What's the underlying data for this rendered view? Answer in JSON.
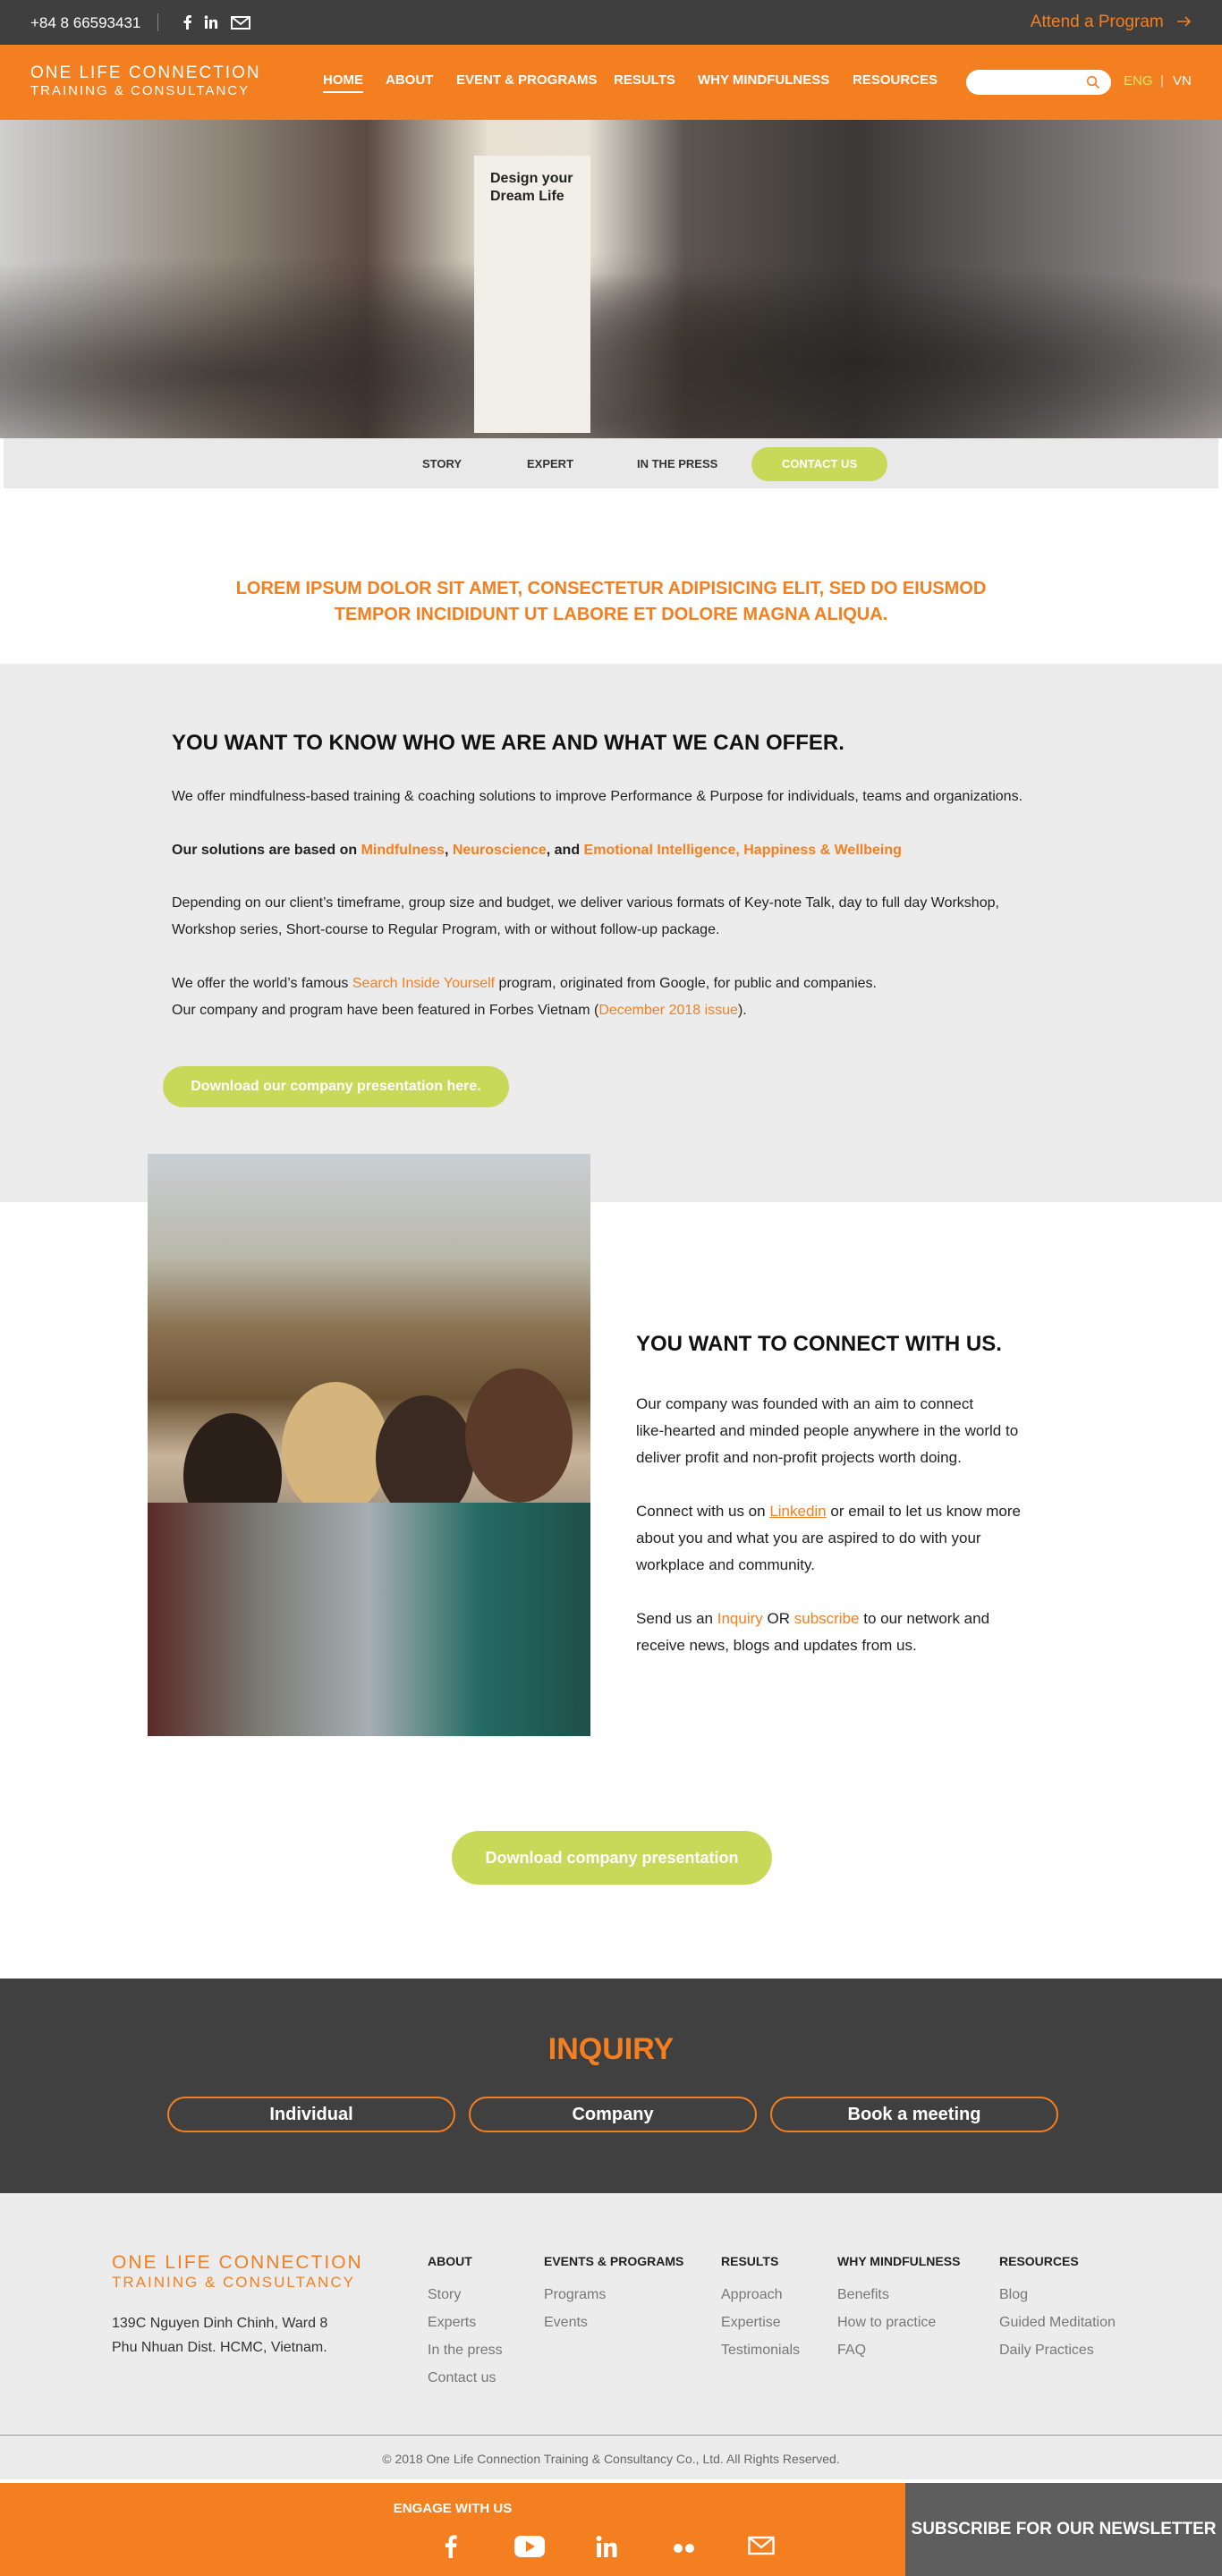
{
  "topbar": {
    "phone": "+84 8 66593431",
    "social_icons": [
      "facebook-icon",
      "linkedin-icon",
      "mail-icon"
    ],
    "attend": "Attend a Program"
  },
  "nav": {
    "logo_line1": "ONE LIFE CONNECTION",
    "logo_line2": "TRAINING & CONSULTANCY",
    "items": [
      "HOME",
      "ABOUT",
      "EVENT & PROGRAMS",
      "RESULTS",
      "WHY MINDFULNESS",
      "RESOURCES"
    ],
    "active": "HOME",
    "search_placeholder": "",
    "lang_en": "ENG",
    "lang_sep": "|",
    "lang_vn": "VN"
  },
  "hero": {
    "banner_text": "Design your Dream Life"
  },
  "subnav": {
    "items": [
      "STORY",
      "EXPERT",
      "IN THE PRESS",
      "CONTACT US"
    ]
  },
  "intro": {
    "line1": "LOREM IPSUM DOLOR SIT AMET, CONSECTETUR ADIPISICING ELIT, SED DO EIUSMOD",
    "line2": "TEMPOR INCIDIDUNT UT LABORE ET DOLORE MAGNA ALIQUA."
  },
  "section1": {
    "heading": "YOU WANT TO KNOW WHO WE ARE AND WHAT WE CAN OFFER.",
    "p1": "We offer mindfulness-based training & coaching solutions to improve Performance & Purpose for individuals, teams and organizations.",
    "p2_prefix": "Our solutions are based on ",
    "p2_a": "Mindfulness",
    "p2_sep1": ", ",
    "p2_b": "Neuroscience",
    "p2_sep2": ", and ",
    "p2_c": "Emotional Intelligence, Happiness & Wellbeing",
    "p3_line1": "Depending on our client’s timeframe, group size and budget, we deliver various formats of Key-note Talk, day to full day Workshop,",
    "p3_line2": "Workshop series, Short-course to Regular Program, with or without follow-up package.",
    "p4_prefix": "We offer the world’s famous ",
    "p4_link": "Search Inside Yourself",
    "p4_suffix": " program, originated from Google, for public and companies.",
    "p5_prefix": "Our company and program have been featured in Forbes Vietnam (",
    "p5_link": "December 2018 issue",
    "p5_suffix": ").",
    "button": "Download our company presentation here."
  },
  "section2": {
    "heading": "YOU WANT TO CONNECT WITH US.",
    "p1_l1": "Our company was founded with an aim to connect",
    "p1_l2": "like-hearted and minded people anywhere in the world to",
    "p1_l3": "deliver profit and non-profit projects worth doing.",
    "p2_prefix": "Connect with us on ",
    "p2_link": "Linkedin",
    "p2_suffix": " or email to let us know more",
    "p2_l2": "about you and what you are aspired to do with your",
    "p2_l3": "workplace and community.",
    "p3_prefix": "Send us an ",
    "p3_link1": "Inquiry",
    "p3_mid": " OR ",
    "p3_link2": "subscribe",
    "p3_suffix": " to our network and",
    "p3_l2": "receive news, blogs and updates from us.",
    "button": "Download company presentation"
  },
  "inquiry": {
    "title": "INQUIRY",
    "buttons": [
      "Individual",
      "Company",
      "Book a meeting"
    ]
  },
  "footer": {
    "logo_line1": "ONE LIFE CONNECTION",
    "logo_line2": "TRAINING & CONSULTANCY",
    "address_l1": "139C Nguyen Dinh Chinh, Ward 8",
    "address_l2": "Phu Nhuan Dist. HCMC, Vietnam.",
    "columns": [
      {
        "head": "ABOUT",
        "links": [
          "Story",
          "Experts",
          "In the press",
          "Contact us"
        ]
      },
      {
        "head": "EVENTS & PROGRAMS",
        "links": [
          "Programs",
          "Events"
        ]
      },
      {
        "head": "RESULTS",
        "links": [
          "Approach",
          "Expertise",
          "Testimonials"
        ]
      },
      {
        "head": "WHY MINDFULNESS",
        "links": [
          "Benefits",
          "How to practice",
          "FAQ"
        ]
      },
      {
        "head": "RESOURCES",
        "links": [
          "Blog",
          "Guided Meditation",
          "Daily Practices"
        ]
      }
    ],
    "copyright": "© 2018 One Life Connection Training & Consultancy Co., Ltd. All Rights Reserved."
  },
  "engage": {
    "title": "ENGAGE WITH US",
    "icons": [
      "facebook-icon",
      "youtube-icon",
      "linkedin-icon",
      "flickr-icon",
      "mail-icon"
    ]
  },
  "subscribe": "SUBSCRIBE FOR OUR NEWSLETTER",
  "colors": {
    "brand_orange": "#f47f20",
    "accent_green": "#c8d95a",
    "dark": "#3f3f3f"
  }
}
